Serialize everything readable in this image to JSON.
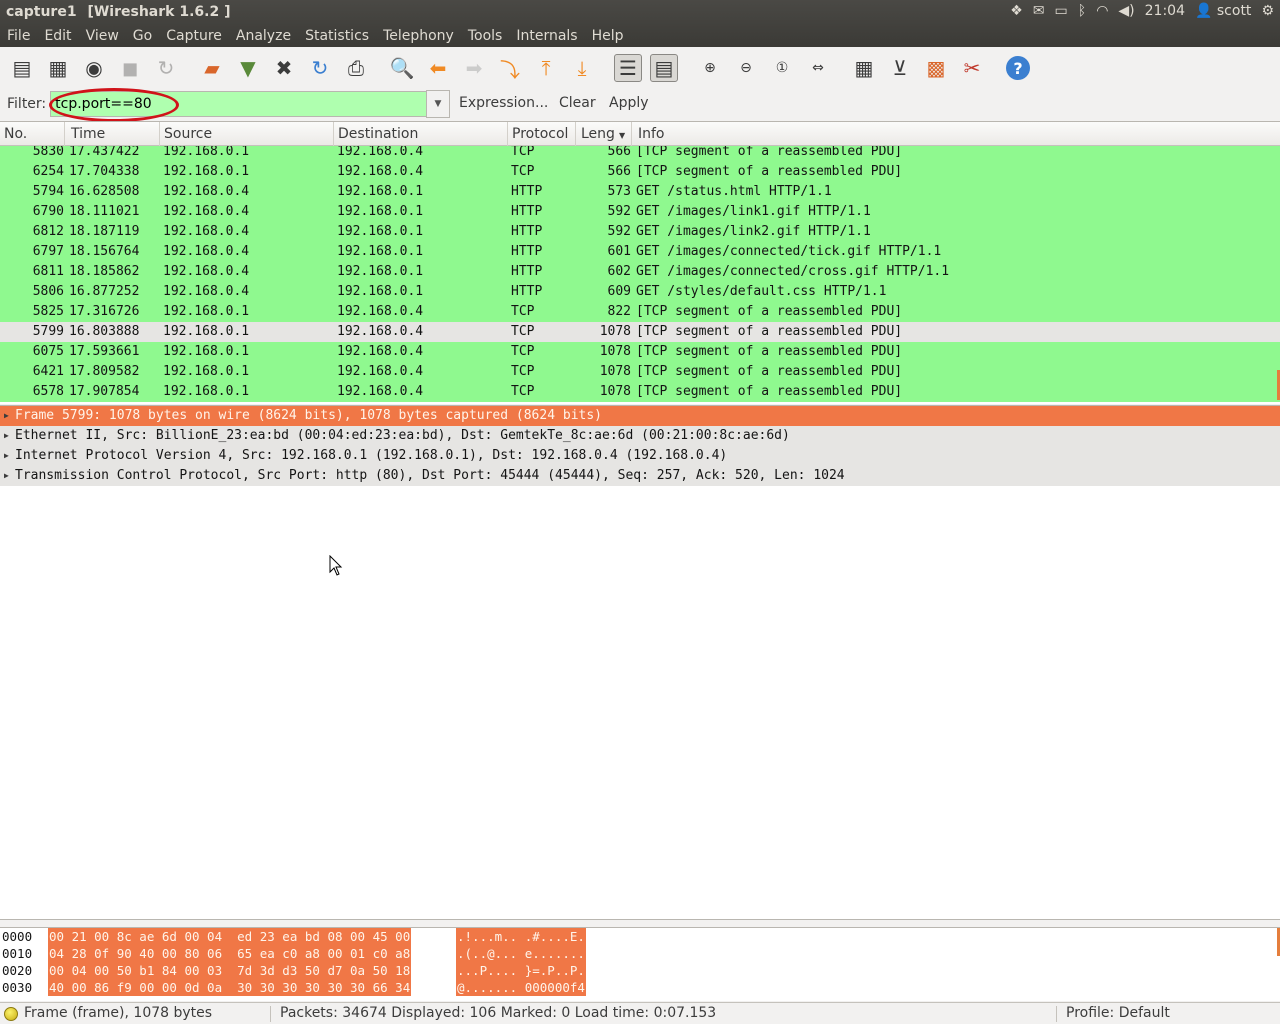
{
  "window": {
    "title_file": "capture1",
    "title_app": "[Wireshark 1.6.2 ]"
  },
  "indicators": {
    "dropbox": "dropbox-icon",
    "mail": "mail-icon",
    "battery": "battery-icon",
    "bluetooth": "bluetooth-icon",
    "wifi": "wifi-icon",
    "volume": "volume-icon",
    "clock": "21:04",
    "user": "scott",
    "session": "gear-icon"
  },
  "menu": [
    "File",
    "Edit",
    "View",
    "Go",
    "Capture",
    "Analyze",
    "Statistics",
    "Telephony",
    "Tools",
    "Internals",
    "Help"
  ],
  "filter": {
    "label": "Filter:",
    "value": "tcp.port==80",
    "expression": "Expression...",
    "clear": "Clear",
    "apply": "Apply",
    "highlight_color": "#d0131a",
    "valid_color": "#afffaf"
  },
  "columns": [
    "No.",
    "Time",
    "Source",
    "Destination",
    "Protocol",
    "Leng",
    "Info"
  ],
  "packets": [
    {
      "no": "5830",
      "time": "17.437422",
      "src": "192.168.0.1",
      "dst": "192.168.0.4",
      "proto": "TCP",
      "len": "566",
      "info": "[TCP segment of a reassembled PDU]",
      "style": "green"
    },
    {
      "no": "6254",
      "time": "17.704338",
      "src": "192.168.0.1",
      "dst": "192.168.0.4",
      "proto": "TCP",
      "len": "566",
      "info": "[TCP segment of a reassembled PDU]",
      "style": "green"
    },
    {
      "no": "5794",
      "time": "16.628508",
      "src": "192.168.0.4",
      "dst": "192.168.0.1",
      "proto": "HTTP",
      "len": "573",
      "info": "GET /status.html HTTP/1.1",
      "style": "green"
    },
    {
      "no": "6790",
      "time": "18.111021",
      "src": "192.168.0.4",
      "dst": "192.168.0.1",
      "proto": "HTTP",
      "len": "592",
      "info": "GET /images/link1.gif HTTP/1.1",
      "style": "green"
    },
    {
      "no": "6812",
      "time": "18.187119",
      "src": "192.168.0.4",
      "dst": "192.168.0.1",
      "proto": "HTTP",
      "len": "592",
      "info": "GET /images/link2.gif HTTP/1.1",
      "style": "green"
    },
    {
      "no": "6797",
      "time": "18.156764",
      "src": "192.168.0.4",
      "dst": "192.168.0.1",
      "proto": "HTTP",
      "len": "601",
      "info": "GET /images/connected/tick.gif HTTP/1.1",
      "style": "green"
    },
    {
      "no": "6811",
      "time": "18.185862",
      "src": "192.168.0.4",
      "dst": "192.168.0.1",
      "proto": "HTTP",
      "len": "602",
      "info": "GET /images/connected/cross.gif HTTP/1.1",
      "style": "green"
    },
    {
      "no": "5806",
      "time": "16.877252",
      "src": "192.168.0.4",
      "dst": "192.168.0.1",
      "proto": "HTTP",
      "len": "609",
      "info": "GET /styles/default.css HTTP/1.1",
      "style": "green"
    },
    {
      "no": "5825",
      "time": "17.316726",
      "src": "192.168.0.1",
      "dst": "192.168.0.4",
      "proto": "TCP",
      "len": "822",
      "info": "[TCP segment of a reassembled PDU]",
      "style": "green"
    },
    {
      "no": "5799",
      "time": "16.803888",
      "src": "192.168.0.1",
      "dst": "192.168.0.4",
      "proto": "TCP",
      "len": "1078",
      "info": "[TCP segment of a reassembled PDU]",
      "style": "selected"
    },
    {
      "no": "6075",
      "time": "17.593661",
      "src": "192.168.0.1",
      "dst": "192.168.0.4",
      "proto": "TCP",
      "len": "1078",
      "info": "[TCP segment of a reassembled PDU]",
      "style": "green"
    },
    {
      "no": "6421",
      "time": "17.809582",
      "src": "192.168.0.1",
      "dst": "192.168.0.4",
      "proto": "TCP",
      "len": "1078",
      "info": "[TCP segment of a reassembled PDU]",
      "style": "green"
    },
    {
      "no": "6578",
      "time": "17.907854",
      "src": "192.168.0.1",
      "dst": "192.168.0.4",
      "proto": "TCP",
      "len": "1078",
      "info": "[TCP segment of a reassembled PDU]",
      "style": "green"
    }
  ],
  "details": [
    {
      "text": "Frame 5799: 1078 bytes on wire (8624 bits), 1078 bytes captured (8624 bits)",
      "active": true
    },
    {
      "text": "Ethernet II, Src: BillionE_23:ea:bd (00:04:ed:23:ea:bd), Dst: GemtekTe_8c:ae:6d (00:21:00:8c:ae:6d)",
      "active": false
    },
    {
      "text": "Internet Protocol Version 4, Src: 192.168.0.1 (192.168.0.1), Dst: 192.168.0.4 (192.168.0.4)",
      "active": false
    },
    {
      "text": "Transmission Control Protocol, Src Port: http (80), Dst Port: 45444 (45444), Seq: 257, Ack: 520, Len: 1024",
      "active": false
    }
  ],
  "bytes": [
    {
      "off": "0000",
      "hex": "00 21 00 8c ae 6d 00 04  ed 23 ea bd 08 00 45 00",
      "ascii": ".!...m.. .#....E."
    },
    {
      "off": "0010",
      "hex": "04 28 0f 90 40 00 80 06  65 ea c0 a8 00 01 c0 a8",
      "ascii": ".(..@... e......."
    },
    {
      "off": "0020",
      "hex": "00 04 00 50 b1 84 00 03  7d 3d d3 50 d7 0a 50 18",
      "ascii": "...P.... }=.P..P."
    },
    {
      "off": "0030",
      "hex": "40 00 86 f9 00 00 0d 0a  30 30 30 30 30 30 66 34",
      "ascii": "@....... 000000f4"
    }
  ],
  "status": {
    "frame": "Frame (frame), 1078 bytes",
    "packets": "Packets: 34674 Displayed: 106 Marked: 0 Load time: 0:07.153",
    "profile": "Profile: Default"
  }
}
